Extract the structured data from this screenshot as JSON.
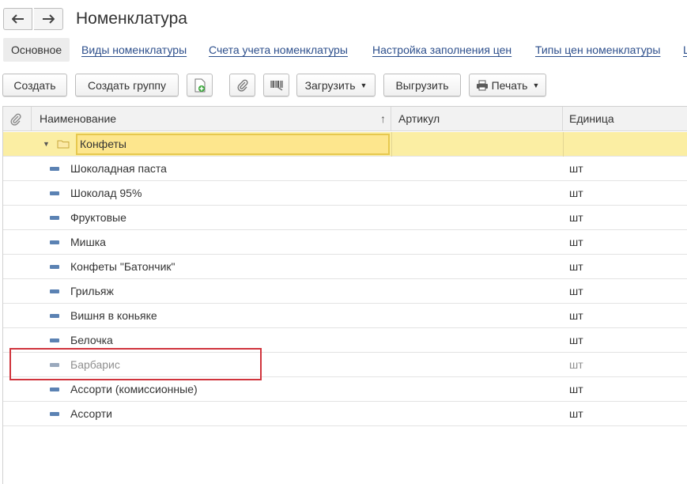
{
  "window": {
    "title": "Номенклатура"
  },
  "tabs": [
    {
      "label": "Основное",
      "active": true
    },
    {
      "label": "Виды номенклатуры"
    },
    {
      "label": "Счета учета номенклатуры"
    },
    {
      "label": "Настройка заполнения цен"
    },
    {
      "label": "Типы цен номенклатуры"
    },
    {
      "label": "Ц"
    }
  ],
  "toolbar": {
    "create_label": "Создать",
    "create_group_label": "Создать группу",
    "load_label": "Загрузить",
    "unload_label": "Выгрузить",
    "print_label": "Печать"
  },
  "table": {
    "columns": {
      "name": "Наименование",
      "article": "Артикул",
      "unit": "Единица"
    },
    "sort_indicator": "↑",
    "group": {
      "name": "Конфеты"
    },
    "rows": [
      {
        "name": "Шоколадная паста",
        "unit": "шт"
      },
      {
        "name": "Шоколад 95%",
        "unit": "шт"
      },
      {
        "name": "Фруктовые",
        "unit": "шт"
      },
      {
        "name": "Мишка",
        "unit": "шт"
      },
      {
        "name": "Конфеты \"Батончик\"",
        "unit": "шт"
      },
      {
        "name": "Грильяж",
        "unit": "шт"
      },
      {
        "name": "Вишня в коньяке",
        "unit": "шт"
      },
      {
        "name": "Белочка",
        "unit": "шт"
      },
      {
        "name": "Барбарис",
        "unit": "шт",
        "deleted": true
      },
      {
        "name": "Ассорти (комиссионные)",
        "unit": "шт"
      },
      {
        "name": "Ассорти",
        "unit": "шт"
      }
    ]
  },
  "colors": {
    "link": "#2d4f8c",
    "group_row": "#fbeea3",
    "highlight": "#d0343c",
    "item_icon": "#5b82b3"
  }
}
